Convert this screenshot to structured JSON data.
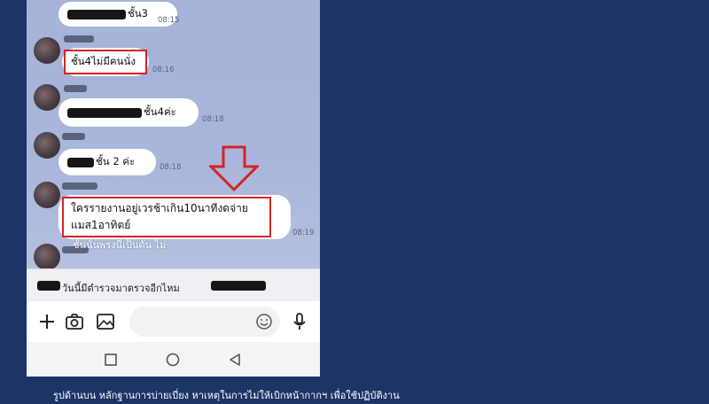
{
  "messages": [
    {
      "text": "ชั้น3",
      "time": "08:15"
    },
    {
      "text": "ชั้น4ไม่มีคนนั่ง",
      "time": "08:16",
      "highlighted": true
    },
    {
      "text": "ชั้น4ค่ะ",
      "time": "08:18"
    },
    {
      "text": "ชั้น 2 ค่ะ",
      "time": "08:18"
    },
    {
      "text": "ใครรายงานอยู่เวรช้าเกิน10นาทีงดจ่าย\nแมส1อาทิตย์",
      "time": "08:19",
      "highlighted": true
    }
  ],
  "partial_message": "ชั้นนั้นพรงนี้เป็นดัน ไม่",
  "announcement_banner": "วันนี้มีตำรวจมาตรวจอีกไหม",
  "input": {
    "placeholder": ""
  },
  "toolbar_icons": [
    "plus-icon",
    "camera-icon",
    "image-icon",
    "emoji-icon",
    "microphone-icon"
  ],
  "nav_icons": [
    "recent-apps-icon",
    "home-icon",
    "back-icon"
  ],
  "annotation_color": "#d42424",
  "caption": "รูปด้านบน  หลักฐานการบ่ายเบี่ยง หาเหตุในการไม่ให้เบิกหน้ากากฯ เพื่อใช้ปฏิบัติงาน"
}
